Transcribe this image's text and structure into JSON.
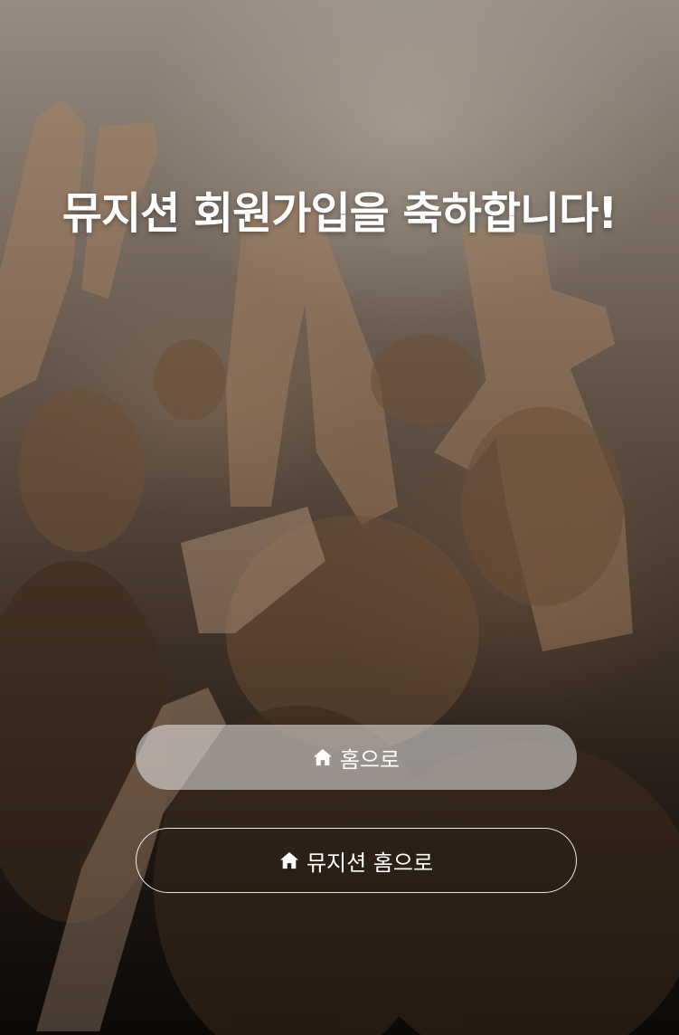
{
  "hero": {
    "headline": "뮤지션 회원가입을 축하합니다!"
  },
  "actions": {
    "home_label": "홈으로",
    "home_icon": "home-icon",
    "musician_home_label": "뮤지션 홈으로",
    "musician_home_icon": "home-icon"
  },
  "colors": {
    "text": "#ffffff",
    "primary_button_bg": "rgba(235,235,235,0.55)",
    "outline_button_border": "#ffffff"
  }
}
